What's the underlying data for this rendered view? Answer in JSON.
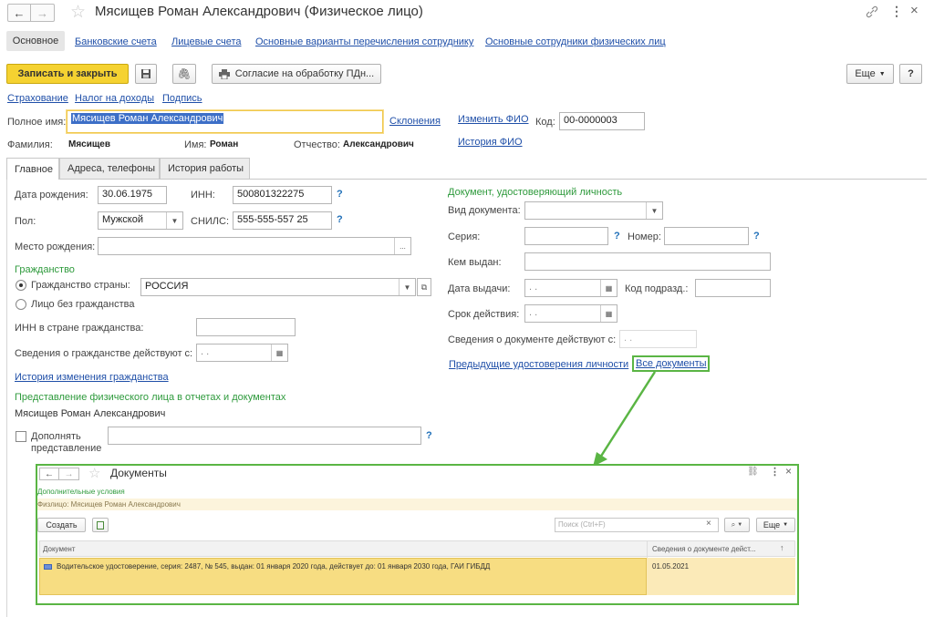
{
  "window": {
    "title": "Мясищев Роман Александрович (Физическое лицо)"
  },
  "nav_tabs": [
    "Основное",
    "Банковские счета",
    "Лицевые счета",
    "Основные варианты перечисления сотруднику",
    "Основные сотрудники физических лиц"
  ],
  "toolbar": {
    "save_close": "Записать и закрыть",
    "consent": "Согласие на обработку ПДн...",
    "more": "Еще",
    "help": "?"
  },
  "links_row": [
    "Страхование",
    "Налог на доходы",
    "Подпись"
  ],
  "fio": {
    "full_name_label": "Полное имя:",
    "full_name": "Мясищев Роман Александрович",
    "declensions": "Склонения",
    "change": "Изменить ФИО",
    "history": "История ФИО",
    "code_label": "Код:",
    "code": "00-0000003",
    "surname_label": "Фамилия:",
    "surname": "Мясищев",
    "name_label": "Имя:",
    "name": "Роман",
    "patronymic_label": "Отчество:",
    "patronymic": "Александрович"
  },
  "tabs": [
    "Главное",
    "Адреса, телефоны",
    "История работы"
  ],
  "main": {
    "birth_label": "Дата рождения:",
    "birth": "30.06.1975",
    "inn_label": "ИНН:",
    "inn": "500801322275",
    "sex_label": "Пол:",
    "sex": "Мужской",
    "snils_label": "СНИЛС:",
    "snils": "555-555-557 25",
    "birthplace_label": "Место рождения:",
    "citizenship_title": "Гражданство",
    "country_radio": "Гражданство страны:",
    "country": "РОССИЯ",
    "stateless_radio": "Лицо без гражданства",
    "inn_foreign_label": "ИНН в стране гражданства:",
    "cit_valid_label": "Сведения о гражданстве действуют с:",
    "cit_history": "История изменения гражданства",
    "repr_title": "Представление физического лица в отчетах и документах",
    "repr": "Мясищев Роман Александрович",
    "supplement_label_1": "Дополнять",
    "supplement_label_2": "представление",
    "date_placeholder": " .  ."
  },
  "doc": {
    "title": "Документ, удостоверяющий личность",
    "type_label": "Вид документа:",
    "series_label": "Серия:",
    "number_label": "Номер:",
    "issuer_label": "Кем выдан:",
    "issue_date_label": "Дата выдачи:",
    "dept_code_label": "Код подразд.:",
    "expiry_label": "Срок действия:",
    "valid_label": "Сведения о документе действуют с:",
    "prev_link": "Предыдущие удостоверения личности",
    "all_link": "Все документы"
  },
  "popup": {
    "title": "Документы",
    "extra_conditions": "Дополнительные условия",
    "filter": "Физлицо: Мясищев Роман Александрович",
    "create": "Создать",
    "search_placeholder": "Поиск (Ctrl+F)",
    "more": "Еще",
    "columns": [
      "Документ",
      "Сведения о документе дейст..."
    ],
    "rows": [
      {
        "doc": "Водительское удостоверение, серия: 2487, № 545, выдан: 01 января 2020 года, действует до: 01 января 2030 года, ГАИ ГИБДД",
        "date": "01.05.2021"
      }
    ]
  },
  "colors": {
    "accent_yellow": "#f5d231",
    "link": "#1f4fa8",
    "green": "#2e9a3c",
    "highlight_border": "#5ab544"
  }
}
